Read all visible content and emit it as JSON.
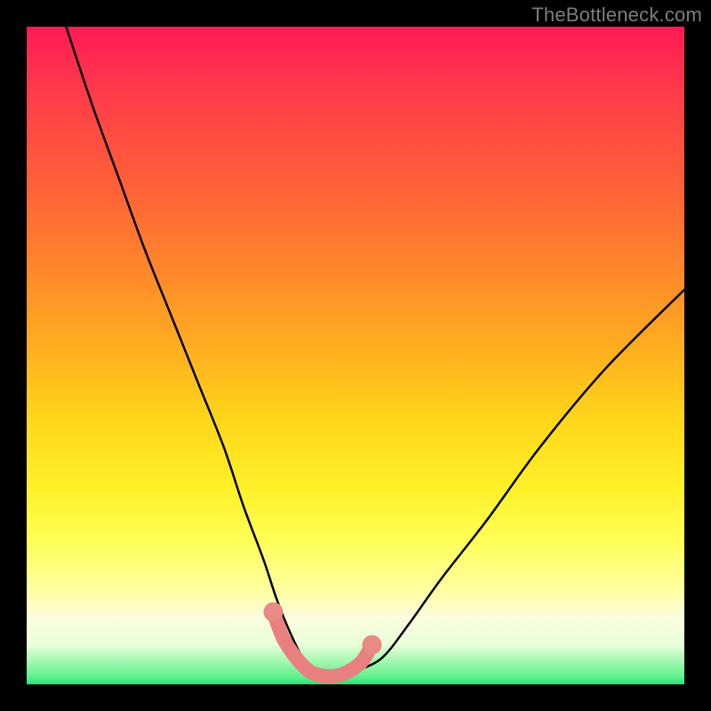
{
  "watermark": {
    "text": "TheBottleneck.com"
  },
  "colors": {
    "frame": "#000000",
    "curve": "#000000",
    "marker_stroke": "#e98080",
    "marker_fill": "#e88a86",
    "gradient_stops": [
      "#ff1a55",
      "#ff3b4a",
      "#ff6038",
      "#ff8a2a",
      "#ffb21e",
      "#ffd71a",
      "#fff028",
      "#ffff55",
      "#ffffa5",
      "#fafce0",
      "#e8ffd8",
      "#5df08a",
      "#22e27a"
    ]
  },
  "chart_data": {
    "type": "line",
    "title": "",
    "xlabel": "",
    "ylabel": "",
    "xlim": [
      0,
      100
    ],
    "ylim": [
      0,
      100
    ],
    "grid": false,
    "legend": false,
    "series": [
      {
        "name": "bottleneck-curve",
        "x": [
          6,
          10,
          14,
          18,
          22,
          26,
          30,
          33,
          36,
          38,
          40,
          42,
          44,
          46,
          48,
          50,
          54,
          58,
          63,
          70,
          78,
          88,
          100
        ],
        "y": [
          100,
          88,
          77,
          66,
          56,
          46,
          36,
          27,
          19,
          13,
          8,
          4,
          2,
          1,
          1,
          2,
          4,
          9,
          16,
          25,
          36,
          48,
          60
        ]
      }
    ],
    "markers": {
      "name": "highlighted-band",
      "x": [
        37.5,
        39,
        41,
        43,
        45,
        47,
        49,
        51,
        52.5
      ],
      "y": [
        11,
        7,
        4,
        2,
        1.3,
        1.3,
        2,
        3.5,
        6
      ]
    }
  }
}
